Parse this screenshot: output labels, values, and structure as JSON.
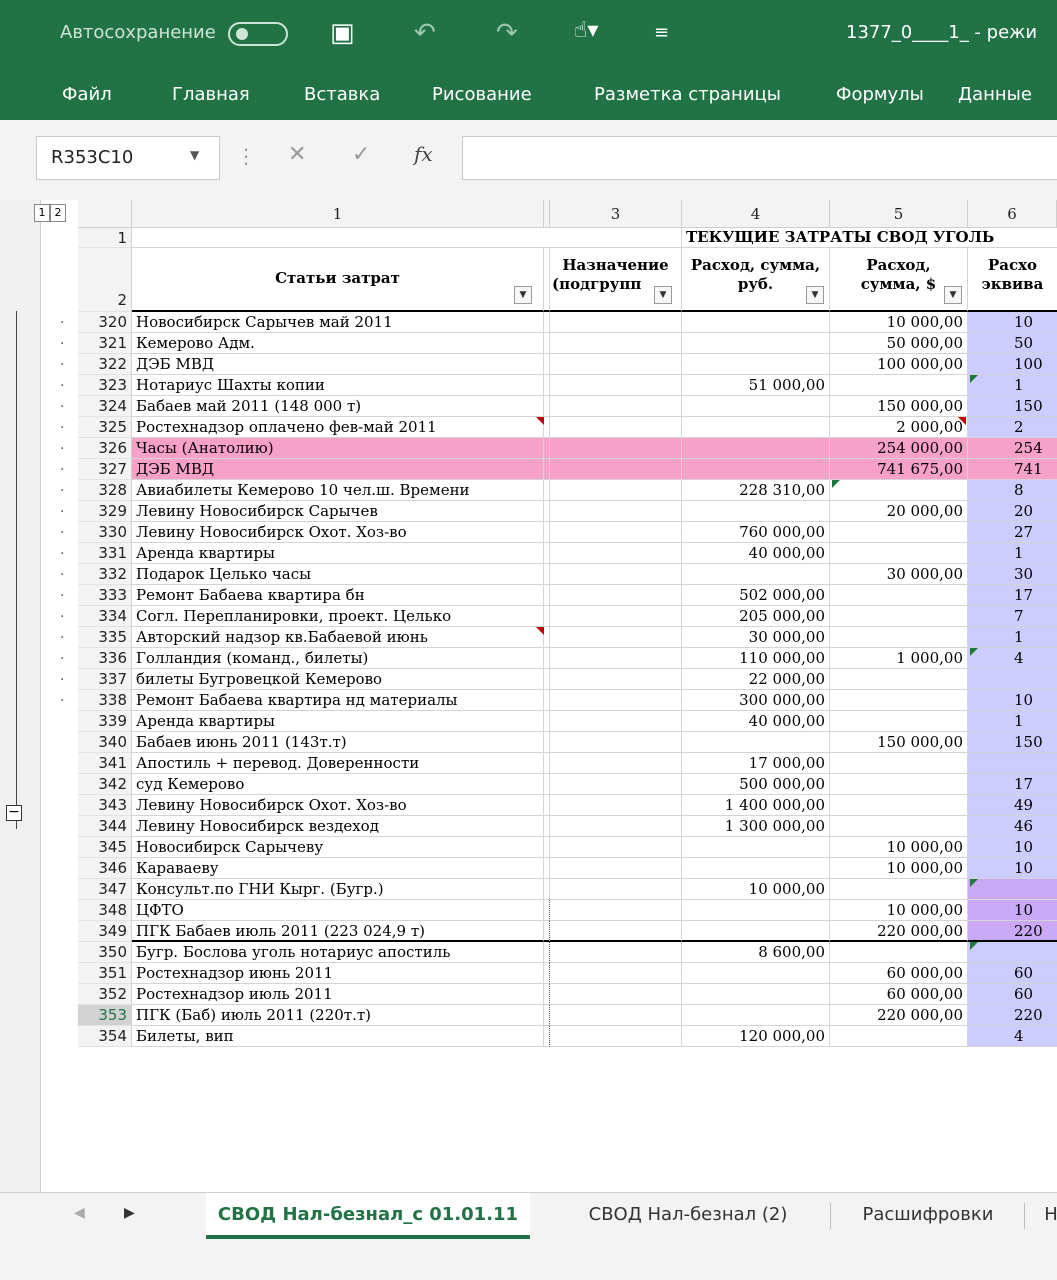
{
  "titlebar": {
    "autosave_label": "Автосохранение",
    "filename": "1377_0____1_ - режи",
    "save_icon": "save-icon",
    "undo_icon": "undo-icon",
    "redo_icon": "redo-icon"
  },
  "ribbon": {
    "tabs": [
      "Файл",
      "Главная",
      "Вставка",
      "Рисование",
      "Разметка страницы",
      "Формулы",
      "Данные"
    ]
  },
  "formula_bar": {
    "name_box": "R353C10",
    "fx_label": "fx",
    "value": ""
  },
  "outline": {
    "levels": [
      "1",
      "2"
    ]
  },
  "columns": [
    "1",
    "",
    "3",
    "4",
    "5",
    "6"
  ],
  "sheet_title": "ТЕКУЩИЕ ЗАТРАТЫ СВОД УГОЛЬ",
  "headers": {
    "col1": "Статьи затрат",
    "col3": [
      "Назначение",
      "(подгрупп"
    ],
    "col4": [
      "Расход, сумма,",
      "руб."
    ],
    "col5": [
      "Расход,",
      "сумма, $"
    ],
    "col6": [
      "Расхо",
      "эквива"
    ]
  },
  "rows": [
    {
      "n": "1",
      "c1": "",
      "c4": "",
      "c5": "",
      "c6": ""
    },
    {
      "n": "2",
      "c1": "",
      "c4": "",
      "c5": "",
      "c6": ""
    },
    {
      "n": "320",
      "c1": "Новосибирск Сарычев май 2011",
      "c4": "",
      "c5": "10 000,00",
      "c6": "10"
    },
    {
      "n": "321",
      "c1": "Кемерово Адм.",
      "c4": "",
      "c5": "50 000,00",
      "c6": "50"
    },
    {
      "n": "322",
      "c1": "ДЭБ МВД",
      "c4": "",
      "c5": "100 000,00",
      "c6": "100"
    },
    {
      "n": "323",
      "c1": "Нотариус Шахты копии",
      "c4": "51 000,00",
      "c5": "",
      "c6": "1"
    },
    {
      "n": "324",
      "c1": "Бабаев май 2011 (148 000 т)",
      "c4": "",
      "c5": "150 000,00",
      "c6": "150"
    },
    {
      "n": "325",
      "c1": "Ростехнадзор оплачено фев-май 2011",
      "c4": "",
      "c5": "2 000,00",
      "c6": "2"
    },
    {
      "n": "326",
      "c1": "Часы  (Анатолию)",
      "c4": "",
      "c5": "254 000,00",
      "c6": "254"
    },
    {
      "n": "327",
      "c1": "ДЭБ МВД",
      "c4": "",
      "c5": "741 675,00",
      "c6": "741"
    },
    {
      "n": "328",
      "c1": "Авиабилеты Кемерово 10 чел.ш. Времени",
      "c4": "228 310,00",
      "c5": "",
      "c6": "8"
    },
    {
      "n": "329",
      "c1": "Левину Новосибирск Сарычев",
      "c4": "",
      "c5": "20 000,00",
      "c6": "20"
    },
    {
      "n": "330",
      "c1": "Левину Новосибирск Охот. Хоз-во",
      "c4": "760 000,00",
      "c5": "",
      "c6": "27"
    },
    {
      "n": "331",
      "c1": "Аренда квартиры",
      "c4": "40 000,00",
      "c5": "",
      "c6": "1"
    },
    {
      "n": "332",
      "c1": "Подарок Целько часы",
      "c4": "",
      "c5": "30 000,00",
      "c6": "30"
    },
    {
      "n": "333",
      "c1": "Ремонт Бабаева квартира бн",
      "c4": "502 000,00",
      "c5": "",
      "c6": "17"
    },
    {
      "n": "334",
      "c1": "Согл. Перепланировки, проект. Целько",
      "c4": "205 000,00",
      "c5": "",
      "c6": "7"
    },
    {
      "n": "335",
      "c1": "Авторский надзор кв.Бабаевой июнь",
      "c4": "30 000,00",
      "c5": "",
      "c6": "1"
    },
    {
      "n": "336",
      "c1": "Голландия (команд., билеты)",
      "c4": "110 000,00",
      "c5": "1 000,00",
      "c6": "4"
    },
    {
      "n": "337",
      "c1": "билеты Бугровецкой Кемерово",
      "c4": "22 000,00",
      "c5": "",
      "c6": ""
    },
    {
      "n": "338",
      "c1": "Ремонт Бабаева квартира нд материалы",
      "c4": "300 000,00",
      "c5": "",
      "c6": "10"
    },
    {
      "n": "339",
      "c1": "Аренда квартиры",
      "c4": "40 000,00",
      "c5": "",
      "c6": "1"
    },
    {
      "n": "340",
      "c1": "Бабаев июнь 2011 (143т.т)",
      "c4": "",
      "c5": "150 000,00",
      "c6": "150"
    },
    {
      "n": "341",
      "c1": "Апостиль + перевод. Доверенности",
      "c4": "17 000,00",
      "c5": "",
      "c6": ""
    },
    {
      "n": "342",
      "c1": "суд Кемерово",
      "c4": "500 000,00",
      "c5": "",
      "c6": "17"
    },
    {
      "n": "343",
      "c1": "Левину Новосибирск Охот. Хоз-во",
      "c4": "1 400 000,00",
      "c5": "",
      "c6": "49"
    },
    {
      "n": "344",
      "c1": "Левину Новосибирск вездеход",
      "c4": "1 300 000,00",
      "c5": "",
      "c6": "46"
    },
    {
      "n": "345",
      "c1": "Новосибирск Сарычеву",
      "c4": "",
      "c5": "10 000,00",
      "c6": "10"
    },
    {
      "n": "346",
      "c1": "Караваеву",
      "c4": "",
      "c5": "10 000,00",
      "c6": "10"
    },
    {
      "n": "347",
      "c1": "Консульт.по ГНИ Кырг. (Бугр.)",
      "c4": "10 000,00",
      "c5": "",
      "c6": ""
    },
    {
      "n": "348",
      "c1": "ЦФТО",
      "c4": "",
      "c5": "10 000,00",
      "c6": "10"
    },
    {
      "n": "349",
      "c1": "ПГК Бабаев июль 2011 (223 024,9 т)",
      "c4": "",
      "c5": "220 000,00",
      "c6": "220"
    },
    {
      "n": "350",
      "c1": "Бугр. Бослова уголь нотариус апостиль",
      "c4": "8 600,00",
      "c5": "",
      "c6": ""
    },
    {
      "n": "351",
      "c1": "Ростехнадзор июнь 2011",
      "c4": "",
      "c5": "60 000,00",
      "c6": "60"
    },
    {
      "n": "352",
      "c1": "Ростехнадзор июль 2011",
      "c4": "",
      "c5": "60 000,00",
      "c6": "60"
    },
    {
      "n": "353",
      "c1": "ПГК (Баб) июль 2011 (220т.т)",
      "c4": "",
      "c5": "220 000,00",
      "c6": "220"
    },
    {
      "n": "354",
      "c1": "Билеты, вип",
      "c4": "120 000,00",
      "c5": "",
      "c6": "4"
    }
  ],
  "sheet_tabs": [
    "СВОД Нал-безнал_с 01.01.11",
    "СВОД Нал-безнал (2)",
    "Расшифровки",
    "Н"
  ],
  "colors": {
    "excel_green": "#217346",
    "pink_highlight": "#f7a1c8",
    "lavender": "#ccccff",
    "violet": "#c9a8f5"
  }
}
